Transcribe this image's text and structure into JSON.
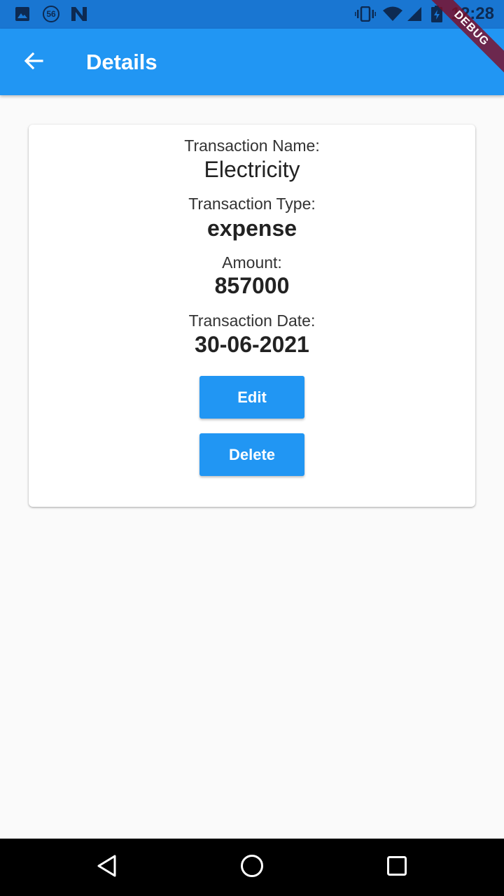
{
  "status_bar": {
    "notification_badge": "56",
    "clock": "12:28",
    "icons": [
      "image-icon",
      "badge-56-icon",
      "n-logo-icon",
      "vibrate-icon",
      "wifi-icon",
      "signal-icon",
      "battery-charging-icon"
    ]
  },
  "app_bar": {
    "title": "Details",
    "back_icon": "arrow-back-icon",
    "debug_banner": "DEBUG",
    "color": "#2196f3"
  },
  "details": {
    "name_label": "Transaction Name:",
    "name_value": "Electricity",
    "type_label": "Transaction Type:",
    "type_value": "expense",
    "amount_label": "Amount:",
    "amount_value": "857000",
    "date_label": "Transaction Date:",
    "date_value": "30-06-2021"
  },
  "actions": {
    "edit_label": "Edit",
    "delete_label": "Delete"
  },
  "nav_bar": {
    "icons": [
      "nav-back-icon",
      "nav-home-icon",
      "nav-recents-icon"
    ]
  }
}
